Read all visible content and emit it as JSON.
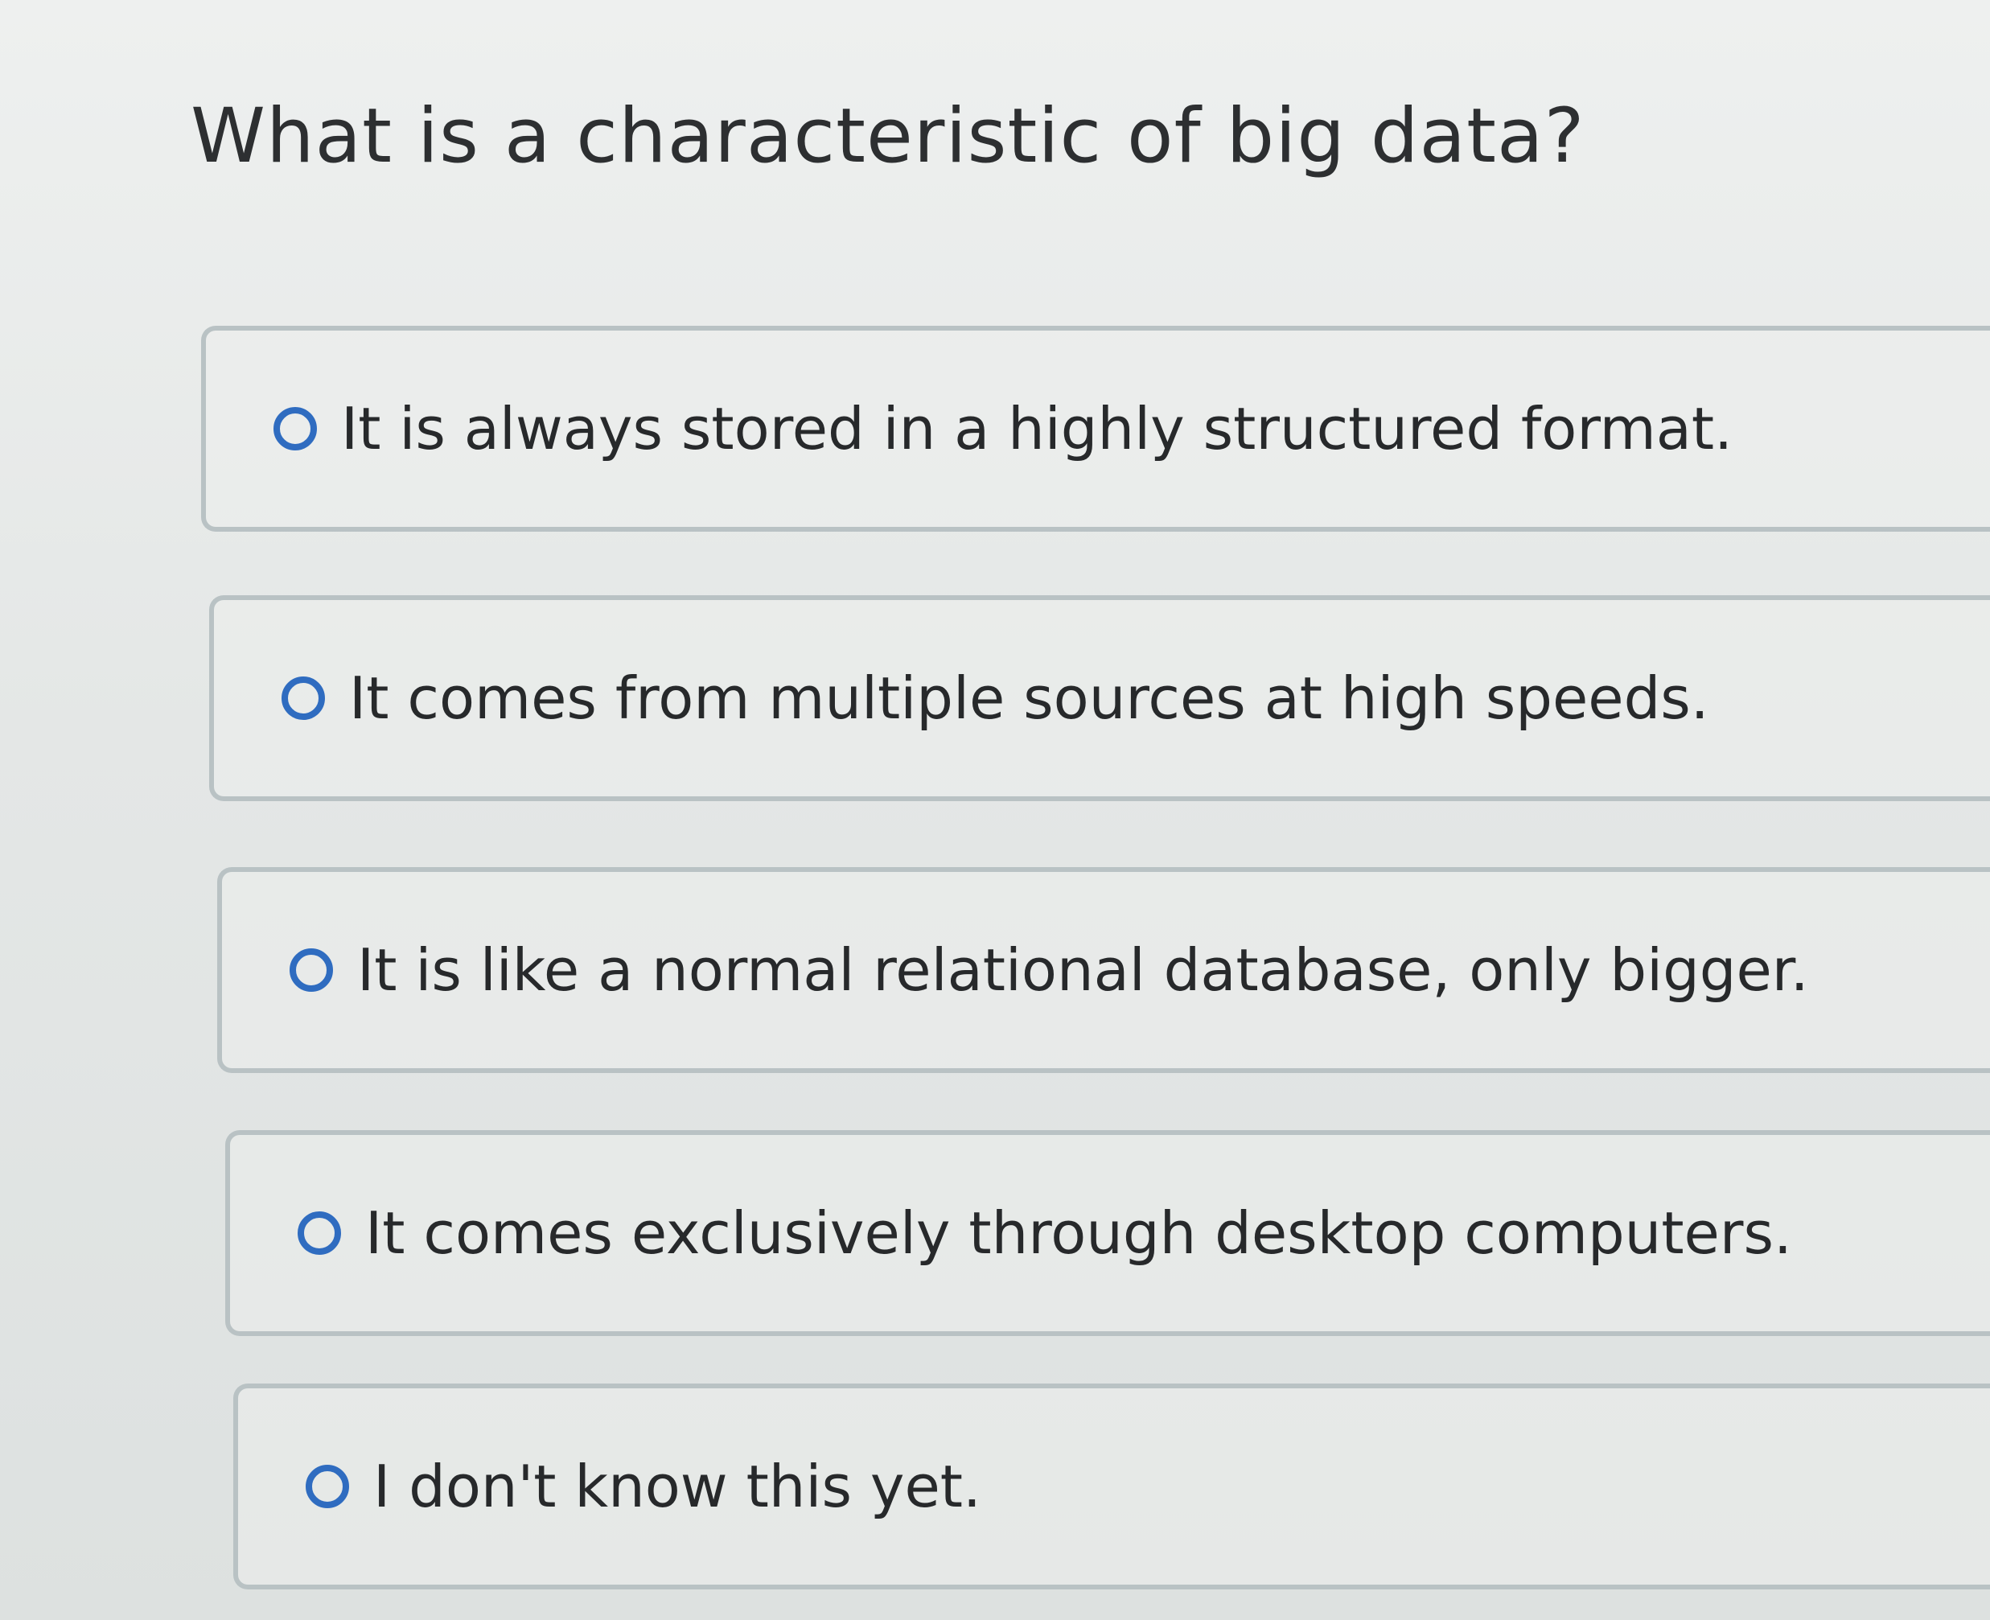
{
  "question": {
    "text": "What is a characteristic of big data?"
  },
  "options": [
    {
      "label": "It is always stored in a highly structured format.",
      "selected": false
    },
    {
      "label": "It comes from multiple sources at high speeds.",
      "selected": false
    },
    {
      "label": "It is like a normal relational database, only bigger.",
      "selected": false
    },
    {
      "label": "It comes exclusively through desktop computers.",
      "selected": false
    },
    {
      "label": "I don't know this yet.",
      "selected": false
    }
  ],
  "colors": {
    "radio_border": "#2f6cc0",
    "option_border": "#b9c2c4",
    "text": "#27292b",
    "background": "#e6e8e8"
  }
}
